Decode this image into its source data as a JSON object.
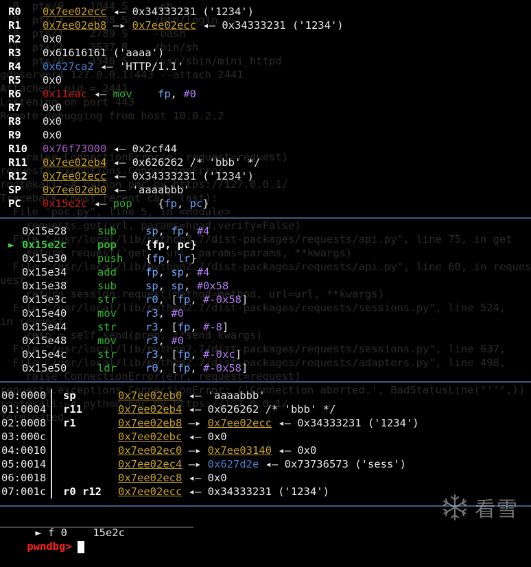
{
  "registers": [
    {
      "name": "R0",
      "parts": [
        [
          "addr-y",
          "0x7ee02ecc"
        ],
        [
          "arrow",
          " ◂— "
        ],
        [
          "txt",
          "0x34333231 ('1234')"
        ]
      ]
    },
    {
      "name": "R1",
      "parts": [
        [
          "addr-y",
          "0x7ee02eb8"
        ],
        [
          "arrow",
          " —▸ "
        ],
        [
          "addr-y",
          "0x7ee02ecc"
        ],
        [
          "arrow",
          " ◂— "
        ],
        [
          "txt",
          "0x34333231 ('1234')"
        ]
      ]
    },
    {
      "name": "R2",
      "parts": [
        [
          "txt",
          "0x0"
        ]
      ]
    },
    {
      "name": "R3",
      "parts": [
        [
          "txt",
          "0x61616161 ('aaaa')"
        ]
      ]
    },
    {
      "name": "R4",
      "parts": [
        [
          "addr-b",
          "0x627ca2"
        ],
        [
          "arrow",
          " ◂— "
        ],
        [
          "txt",
          "'HTTP/1.1'"
        ]
      ]
    },
    {
      "name": "R5",
      "parts": [
        [
          "txt",
          "0x0"
        ]
      ]
    },
    {
      "name": "R6",
      "parts": [
        [
          "addr-r",
          "0x11eac"
        ],
        [
          "arrow",
          " ◂— "
        ],
        [
          "ins",
          "mov    "
        ],
        [
          "opnd",
          "fp"
        ],
        [
          "txt",
          ", "
        ],
        [
          "imm",
          "#0"
        ]
      ]
    },
    {
      "name": "R7",
      "parts": [
        [
          "txt",
          "0x0"
        ]
      ]
    },
    {
      "name": "R8",
      "parts": [
        [
          "txt",
          "0x0"
        ]
      ]
    },
    {
      "name": "R9",
      "parts": [
        [
          "txt",
          "0x0"
        ]
      ]
    },
    {
      "name": "R10",
      "parts": [
        [
          "addr-p",
          "0x76f73000"
        ],
        [
          "arrow",
          " ◂— "
        ],
        [
          "txt",
          "0x2cf44"
        ]
      ]
    },
    {
      "name": "R11",
      "parts": [
        [
          "addr-y",
          "0x7ee02eb4"
        ],
        [
          "arrow",
          " ◂— "
        ],
        [
          "txt",
          "0x626262 /* 'bbb' */"
        ]
      ]
    },
    {
      "name": "R12",
      "parts": [
        [
          "addr-y",
          "0x7ee02ecc"
        ],
        [
          "arrow",
          " ◂— "
        ],
        [
          "txt",
          "0x34333231 ('1234')"
        ]
      ]
    },
    {
      "name": "SP",
      "parts": [
        [
          "addr-y",
          "0x7ee02eb0"
        ],
        [
          "arrow",
          " ◂— "
        ],
        [
          "txt",
          "'aaaabbb'"
        ]
      ]
    },
    {
      "name": "PC",
      "parts": [
        [
          "addr-r",
          "0x15e2c"
        ],
        [
          "arrow",
          " ◂— "
        ],
        [
          "ins",
          "pop    "
        ],
        [
          "txt",
          "{"
        ],
        [
          "opnd",
          "fp"
        ],
        [
          "txt",
          ", "
        ],
        [
          "opnd",
          "pc"
        ],
        [
          "txt",
          "}"
        ]
      ]
    }
  ],
  "disasm": [
    {
      "marker": "",
      "addr": "0x15e28",
      "op": "sub",
      "args": [
        [
          "opnd",
          "sp"
        ],
        [
          "txt",
          ", "
        ],
        [
          "opnd",
          "fp"
        ],
        [
          "txt",
          ", "
        ],
        [
          "imm",
          "#4"
        ]
      ],
      "current": false
    },
    {
      "marker": "►",
      "addr": "0x15e2c",
      "op": "pop",
      "args": [
        [
          "bw",
          "{fp, pc}"
        ]
      ],
      "current": true
    },
    {
      "marker": "",
      "addr": "0x15e30",
      "op": "push",
      "args": [
        [
          "txt",
          "{"
        ],
        [
          "opnd",
          "fp"
        ],
        [
          "txt",
          ", "
        ],
        [
          "opnd",
          "lr"
        ],
        [
          "txt",
          "}"
        ]
      ],
      "current": false
    },
    {
      "marker": "",
      "addr": "0x15e34",
      "op": "add",
      "args": [
        [
          "opnd",
          "fp"
        ],
        [
          "txt",
          ", "
        ],
        [
          "opnd",
          "sp"
        ],
        [
          "txt",
          ", "
        ],
        [
          "imm",
          "#4"
        ]
      ],
      "current": false
    },
    {
      "marker": "",
      "addr": "0x15e38",
      "op": "sub",
      "args": [
        [
          "opnd",
          "sp"
        ],
        [
          "txt",
          ", "
        ],
        [
          "opnd",
          "sp"
        ],
        [
          "txt",
          ", "
        ],
        [
          "imm",
          "#0x58"
        ]
      ],
      "current": false
    },
    {
      "marker": "",
      "addr": "0x15e3c",
      "op": "str",
      "args": [
        [
          "opnd",
          "r0"
        ],
        [
          "txt",
          ", ["
        ],
        [
          "opnd",
          "fp"
        ],
        [
          "txt",
          ", "
        ],
        [
          "imm",
          "#-0x58"
        ],
        [
          "txt",
          "]"
        ]
      ],
      "current": false
    },
    {
      "marker": "",
      "addr": "0x15e40",
      "op": "mov",
      "args": [
        [
          "opnd",
          "r3"
        ],
        [
          "txt",
          ", "
        ],
        [
          "imm",
          "#0"
        ]
      ],
      "current": false
    },
    {
      "marker": "",
      "addr": "0x15e44",
      "op": "str",
      "args": [
        [
          "opnd",
          "r3"
        ],
        [
          "txt",
          ", ["
        ],
        [
          "opnd",
          "fp"
        ],
        [
          "txt",
          ", "
        ],
        [
          "imm",
          "#-8"
        ],
        [
          "txt",
          "]"
        ]
      ],
      "current": false
    },
    {
      "marker": "",
      "addr": "0x15e48",
      "op": "mov",
      "args": [
        [
          "opnd",
          "r3"
        ],
        [
          "txt",
          ", "
        ],
        [
          "imm",
          "#0"
        ]
      ],
      "current": false
    },
    {
      "marker": "",
      "addr": "0x15e4c",
      "op": "str",
      "args": [
        [
          "opnd",
          "r3"
        ],
        [
          "txt",
          ", ["
        ],
        [
          "opnd",
          "fp"
        ],
        [
          "txt",
          ", "
        ],
        [
          "imm",
          "#-0xc"
        ],
        [
          "txt",
          "]"
        ]
      ],
      "current": false
    },
    {
      "marker": "",
      "addr": "0x15e50",
      "op": "ldr",
      "args": [
        [
          "opnd",
          "r0"
        ],
        [
          "txt",
          ", ["
        ],
        [
          "opnd",
          "fp"
        ],
        [
          "txt",
          ", "
        ],
        [
          "imm",
          "#-0x58"
        ],
        [
          "txt",
          "]"
        ]
      ],
      "current": false
    }
  ],
  "stack": [
    {
      "off": "00:0000",
      "regs": "sp",
      "parts": [
        [
          "addr-y",
          "0x7ee02eb0"
        ],
        [
          "arrow",
          " ◂— "
        ],
        [
          "txt",
          "'aaaabbb'"
        ]
      ]
    },
    {
      "off": "01:0004",
      "regs": "r11",
      "parts": [
        [
          "addr-y",
          "0x7ee02eb4"
        ],
        [
          "arrow",
          " ◂— "
        ],
        [
          "txt",
          "0x626262 /* 'bbb' */"
        ]
      ]
    },
    {
      "off": "02:0008",
      "regs": "r1",
      "parts": [
        [
          "addr-y",
          "0x7ee02eb8"
        ],
        [
          "arrow",
          " —▸ "
        ],
        [
          "addr-y",
          "0x7ee02ecc"
        ],
        [
          "arrow",
          " ◂— "
        ],
        [
          "txt",
          "0x34333231 ('1234')"
        ]
      ]
    },
    {
      "off": "03:000c",
      "regs": "",
      "parts": [
        [
          "addr-y",
          "0x7ee02ebc"
        ],
        [
          "arrow",
          " ◂— "
        ],
        [
          "txt",
          "0x0"
        ]
      ]
    },
    {
      "off": "04:0010",
      "regs": "",
      "parts": [
        [
          "addr-y",
          "0x7ee02ec0"
        ],
        [
          "arrow",
          " —▸ "
        ],
        [
          "addr-y",
          "0x7ee03140"
        ],
        [
          "arrow",
          " ◂— "
        ],
        [
          "txt",
          "0x0"
        ]
      ]
    },
    {
      "off": "05:0014",
      "regs": "",
      "parts": [
        [
          "addr-y",
          "0x7ee02ec4"
        ],
        [
          "arrow",
          " —▸ "
        ],
        [
          "addr-b",
          "0x627d2e"
        ],
        [
          "arrow",
          " ◂— "
        ],
        [
          "txt",
          "0x73736573 ('sess')"
        ]
      ]
    },
    {
      "off": "06:0018",
      "regs": "",
      "parts": [
        [
          "addr-y",
          "0x7ee02ec8"
        ],
        [
          "arrow",
          " ◂— "
        ],
        [
          "txt",
          "0x0"
        ]
      ]
    },
    {
      "off": "07:001c",
      "regs": "r0 r12",
      "parts": [
        [
          "addr-y",
          "0x7ee02ecc"
        ],
        [
          "arrow",
          " ◂— "
        ],
        [
          "txt",
          "0x34333231 ('1234')"
        ]
      ]
    }
  ],
  "backtrace": {
    "marker": "►",
    "frame": "f 0",
    "addr": "15e2c"
  },
  "prompt": "pwndbg>",
  "watermark": "看雪",
  "background_text": [
    "  8  pts/0    1044 S    -sh",
    "  9  pts/1    2788 S    /bin/login --",
    " 10  pts/1    2789 S    -bash",
    " 11  pts/1    3537 R    /bin/sh",
    "  2  pts/0    3540 S    /usr/sbin/mini_httpd",
    "gdbserver4 127.0.0.1:443 --attach 2441",
    "Attached; pid = 2441",
    "Listening on port 443",
    "Remote debugging from host 10.0.2.2",
    "",
    "",
    "    raise ConnectionError(e, request=request)",
    "requests.exceptions.ConnectionError",
    "root@kali:~# python poc.py https://127.0.0.1/",
    "Traceback (most recent call last):",
    "  File \"poc.py\", line 5, in <module>",
    "    requests.get(url, params=head,verify=False)",
    "  File \"/usr/local/lib/python2.7/dist-packages/requests/api.py\", line 75, in get",
    "    return request('get', url, params=params, **kwargs)",
    "  File \"/usr/local/lib/python2.7/dist-packages/requests/api.py\", line 60, in request",
    "uest",
    "    return session.request(method=method, url=url, **kwargs)",
    "  File \"/usr/local/lib/python2.7/dist-packages/requests/sessions.py\", line 524,",
    "in request",
    "    resp = self.send(prep, **send_kwargs)",
    "  File \"/usr/local/lib/python2.7/dist-packages/requests/sessions.py\", line 637,",
    "  File \"/usr/local/lib/python2.7/dist-packages/requests/adapters.py\", line 498,",
    "    raise ConnectionError(err, request=request)",
    "requests.exceptions.ConnectionError: ('Connection aborted.', BadStatusLine(\"''\",))",
    "root@kali:~# python poc.py https://127.0.0.1/",
    "Terminated"
  ]
}
